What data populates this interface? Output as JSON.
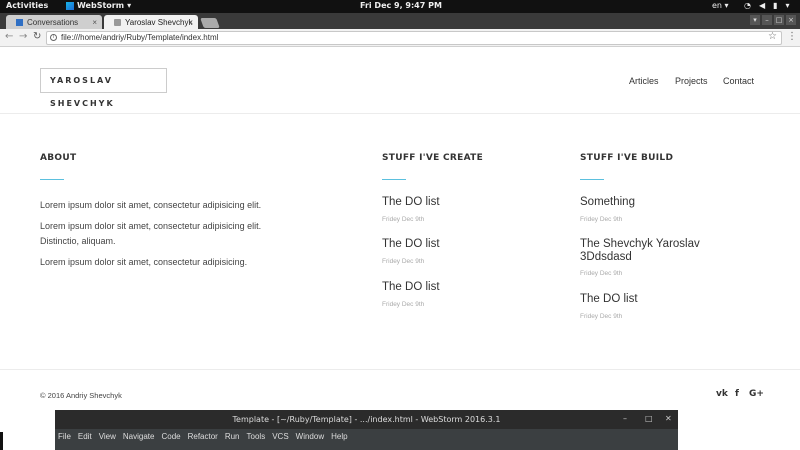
{
  "topbar": {
    "activities": "Activities",
    "app_name": "WebStorm",
    "clock": "Fri Dec  9,  9:47 PM",
    "lang": "en"
  },
  "browser": {
    "tabs": [
      {
        "label": "Conversations",
        "close": "×"
      },
      {
        "label": "Yaroslav Shevchyk",
        "close": "×"
      }
    ],
    "url": "file:///home/andriy/Ruby/Template/index.html"
  },
  "site": {
    "logo": "YAROSLAV SHEVCHYK",
    "nav": [
      "Articles",
      "Projects",
      "Contact"
    ],
    "about": {
      "title": "ABOUT",
      "paragraphs": [
        "Lorem ipsum dolor sit amet, consectetur adipisicing elit.",
        "Lorem ipsum dolor sit amet, consectetur adipisicing elit. Distinctio, aliquam.",
        "Lorem ipsum dolor sit amet, consectetur adipisicing."
      ]
    },
    "created": {
      "title": "STUFF I'VE CREATE",
      "items": [
        {
          "title": "The DO list",
          "date": "Fridey Dec 9th"
        },
        {
          "title": "The DO list",
          "date": "Fridey Dec 9th"
        },
        {
          "title": "The DO list",
          "date": "Fridey Dec 9th"
        }
      ]
    },
    "built": {
      "title": "STUFF I'VE BUILD",
      "items": [
        {
          "title": "Something",
          "date": "Fridey Dec 9th"
        },
        {
          "title": "The Shevchyk Yaroslav 3Ddsdasd",
          "date": "Fridey Dec 9th"
        },
        {
          "title": "The DO list",
          "date": "Fridey Dec 9th"
        }
      ]
    },
    "footer": {
      "copyright": "© 2016 Andriy Shevchyk",
      "social": [
        "vk",
        "f",
        "G+"
      ]
    }
  },
  "webstorm": {
    "title": "Template - [~/Ruby/Template] - .../index.html - WebStorm 2016.3.1",
    "menu": [
      "File",
      "Edit",
      "View",
      "Navigate",
      "Code",
      "Refactor",
      "Run",
      "Tools",
      "VCS",
      "Window",
      "Help"
    ]
  },
  "colors": {
    "accent": "#5bc0de"
  }
}
